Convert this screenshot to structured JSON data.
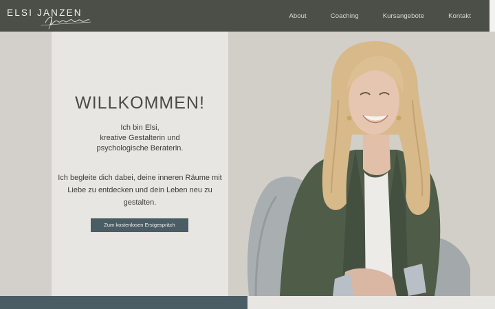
{
  "header": {
    "logo_text": "ELSI JANZEN",
    "logo_script_text": "Home Design"
  },
  "nav": {
    "items": [
      {
        "label": "About"
      },
      {
        "label": "Coaching"
      },
      {
        "label": "Kursangebote"
      },
      {
        "label": "Kontakt"
      }
    ]
  },
  "hero": {
    "title": "WILLKOMMEN!",
    "intro_lines": [
      "Ich bin Elsi,",
      "kreative Gestalterin und",
      "psychologische Beraterin."
    ],
    "mission": "Ich begleite dich dabei, deine inneren Räume mit Liebe zu entdecken und dein Leben neu zu gestalten.",
    "cta_label": "Zum kostenlosen Erstgespräch"
  },
  "colors": {
    "header_bg": "#4b4f48",
    "panel_bg": "#e8e6e2",
    "page_bg": "#d3d0cb",
    "accent": "#4b5d64",
    "nav_text": "#dcdad2"
  }
}
